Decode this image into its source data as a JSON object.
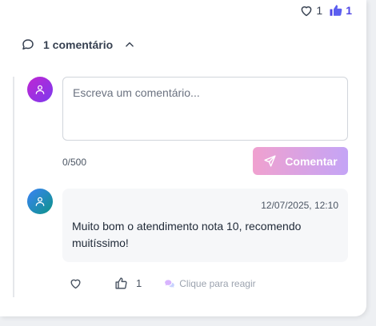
{
  "reactions": {
    "heart_count": "1",
    "like_count": "1",
    "heart_icon": "heart-icon",
    "like_icon": "thumbs-up-icon",
    "like_color": "#4f46e5"
  },
  "comments": {
    "toggle_label": "1 comentário",
    "expanded": true
  },
  "composer": {
    "placeholder": "Escreva um comentário...",
    "value": "",
    "counter": "0/500",
    "submit_label": "Comentar",
    "submit_gradient": [
      "#f0a1cf",
      "#c4a4f6"
    ]
  },
  "comment_list": [
    {
      "date": "12/07/2025, 12:10",
      "text": "Muito bom o atendimento nota 10, recomendo muitíssimo!",
      "like_count": "1",
      "react_hint": "Clique para reagir"
    }
  ],
  "avatar_colors": {
    "me": [
      "#c026d3",
      "#7c3aed"
    ],
    "other": [
      "#3b82f6",
      "#0d9488"
    ]
  }
}
